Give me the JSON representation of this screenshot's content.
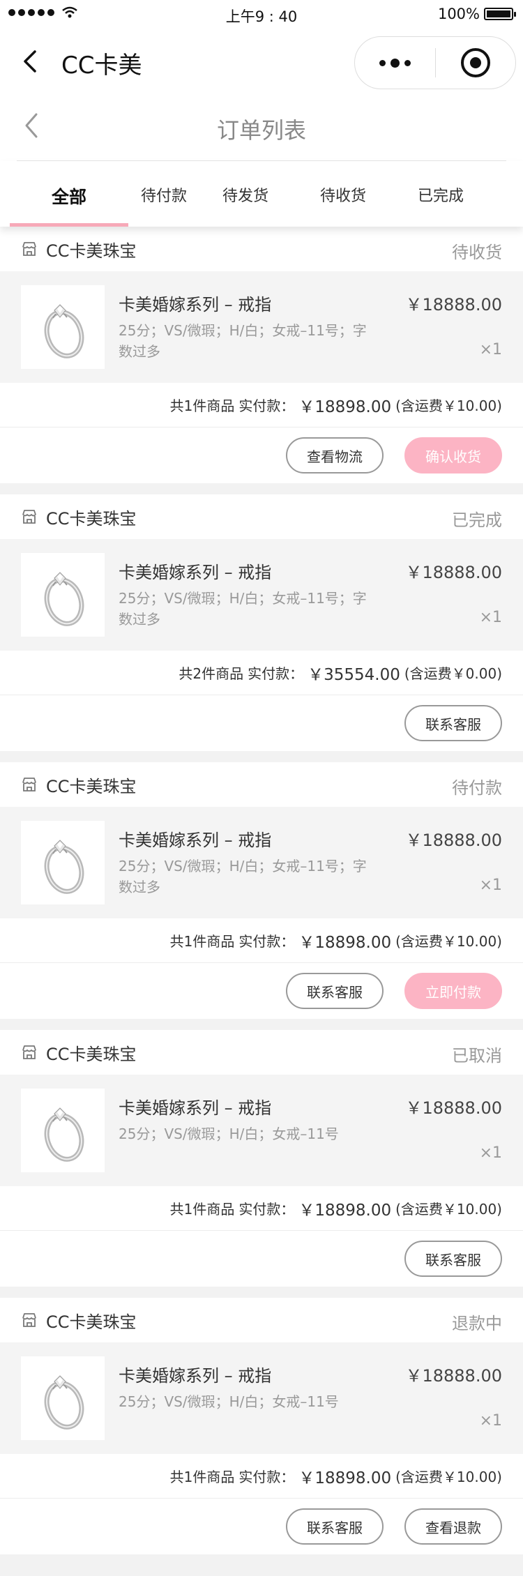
{
  "statusbar": {
    "time": "上午9 : 40",
    "battery": "100%"
  },
  "navbar": {
    "title": "CC卡美"
  },
  "subheader": {
    "title": "订单列表"
  },
  "tabs": [
    "全部",
    "待付款",
    "待发货",
    "待收货",
    "已完成"
  ],
  "active_tab": 0,
  "colors": {
    "accent": "#fcb4c4",
    "tab_indicator": "#f7a9b8"
  },
  "orders": [
    {
      "store": "CC卡美珠宝",
      "status": "待收货",
      "item": {
        "name": "卡美婚嫁系列 – 戒指",
        "spec": "25分；VS/微瑕；H/白；女戒–11号；字数过多",
        "price": "￥18888.00",
        "qty": "×1"
      },
      "summary": {
        "count": "共1件商品",
        "label": "实付款：",
        "amount": "￥18898.00",
        "shipping": "(含运费￥10.00)"
      },
      "buttons": [
        {
          "label": "查看物流",
          "primary": false
        },
        {
          "label": "确认收货",
          "primary": true
        }
      ]
    },
    {
      "store": "CC卡美珠宝",
      "status": "已完成",
      "item": {
        "name": "卡美婚嫁系列 – 戒指",
        "spec": "25分；VS/微瑕；H/白；女戒–11号；字数过多",
        "price": "￥18888.00",
        "qty": "×1"
      },
      "summary": {
        "count": "共2件商品",
        "label": "实付款：",
        "amount": "￥35554.00",
        "shipping": "(含运费￥0.00)"
      },
      "buttons": [
        {
          "label": "联系客服",
          "primary": false
        }
      ]
    },
    {
      "store": "CC卡美珠宝",
      "status": "待付款",
      "item": {
        "name": "卡美婚嫁系列 – 戒指",
        "spec": "25分；VS/微瑕；H/白；女戒–11号；字数过多",
        "price": "￥18888.00",
        "qty": "×1"
      },
      "summary": {
        "count": "共1件商品",
        "label": "实付款：",
        "amount": "￥18898.00",
        "shipping": "(含运费￥10.00)"
      },
      "buttons": [
        {
          "label": "联系客服",
          "primary": false
        },
        {
          "label": "立即付款",
          "primary": true
        }
      ]
    },
    {
      "store": "CC卡美珠宝",
      "status": "已取消",
      "item": {
        "name": "卡美婚嫁系列 – 戒指",
        "spec": "25分；VS/微瑕；H/白；女戒–11号",
        "price": "￥18888.00",
        "qty": "×1"
      },
      "summary": {
        "count": "共1件商品",
        "label": "实付款：",
        "amount": "￥18898.00",
        "shipping": "(含运费￥10.00)"
      },
      "buttons": [
        {
          "label": "联系客服",
          "primary": false
        }
      ]
    },
    {
      "store": "CC卡美珠宝",
      "status": "退款中",
      "item": {
        "name": "卡美婚嫁系列 – 戒指",
        "spec": "25分；VS/微瑕；H/白；女戒–11号",
        "price": "￥18888.00",
        "qty": "×1"
      },
      "summary": {
        "count": "共1件商品",
        "label": "实付款：",
        "amount": "￥18898.00",
        "shipping": "(含运费￥10.00)"
      },
      "buttons": [
        {
          "label": "联系客服",
          "primary": false
        },
        {
          "label": "查看退款",
          "primary": false
        }
      ]
    }
  ]
}
